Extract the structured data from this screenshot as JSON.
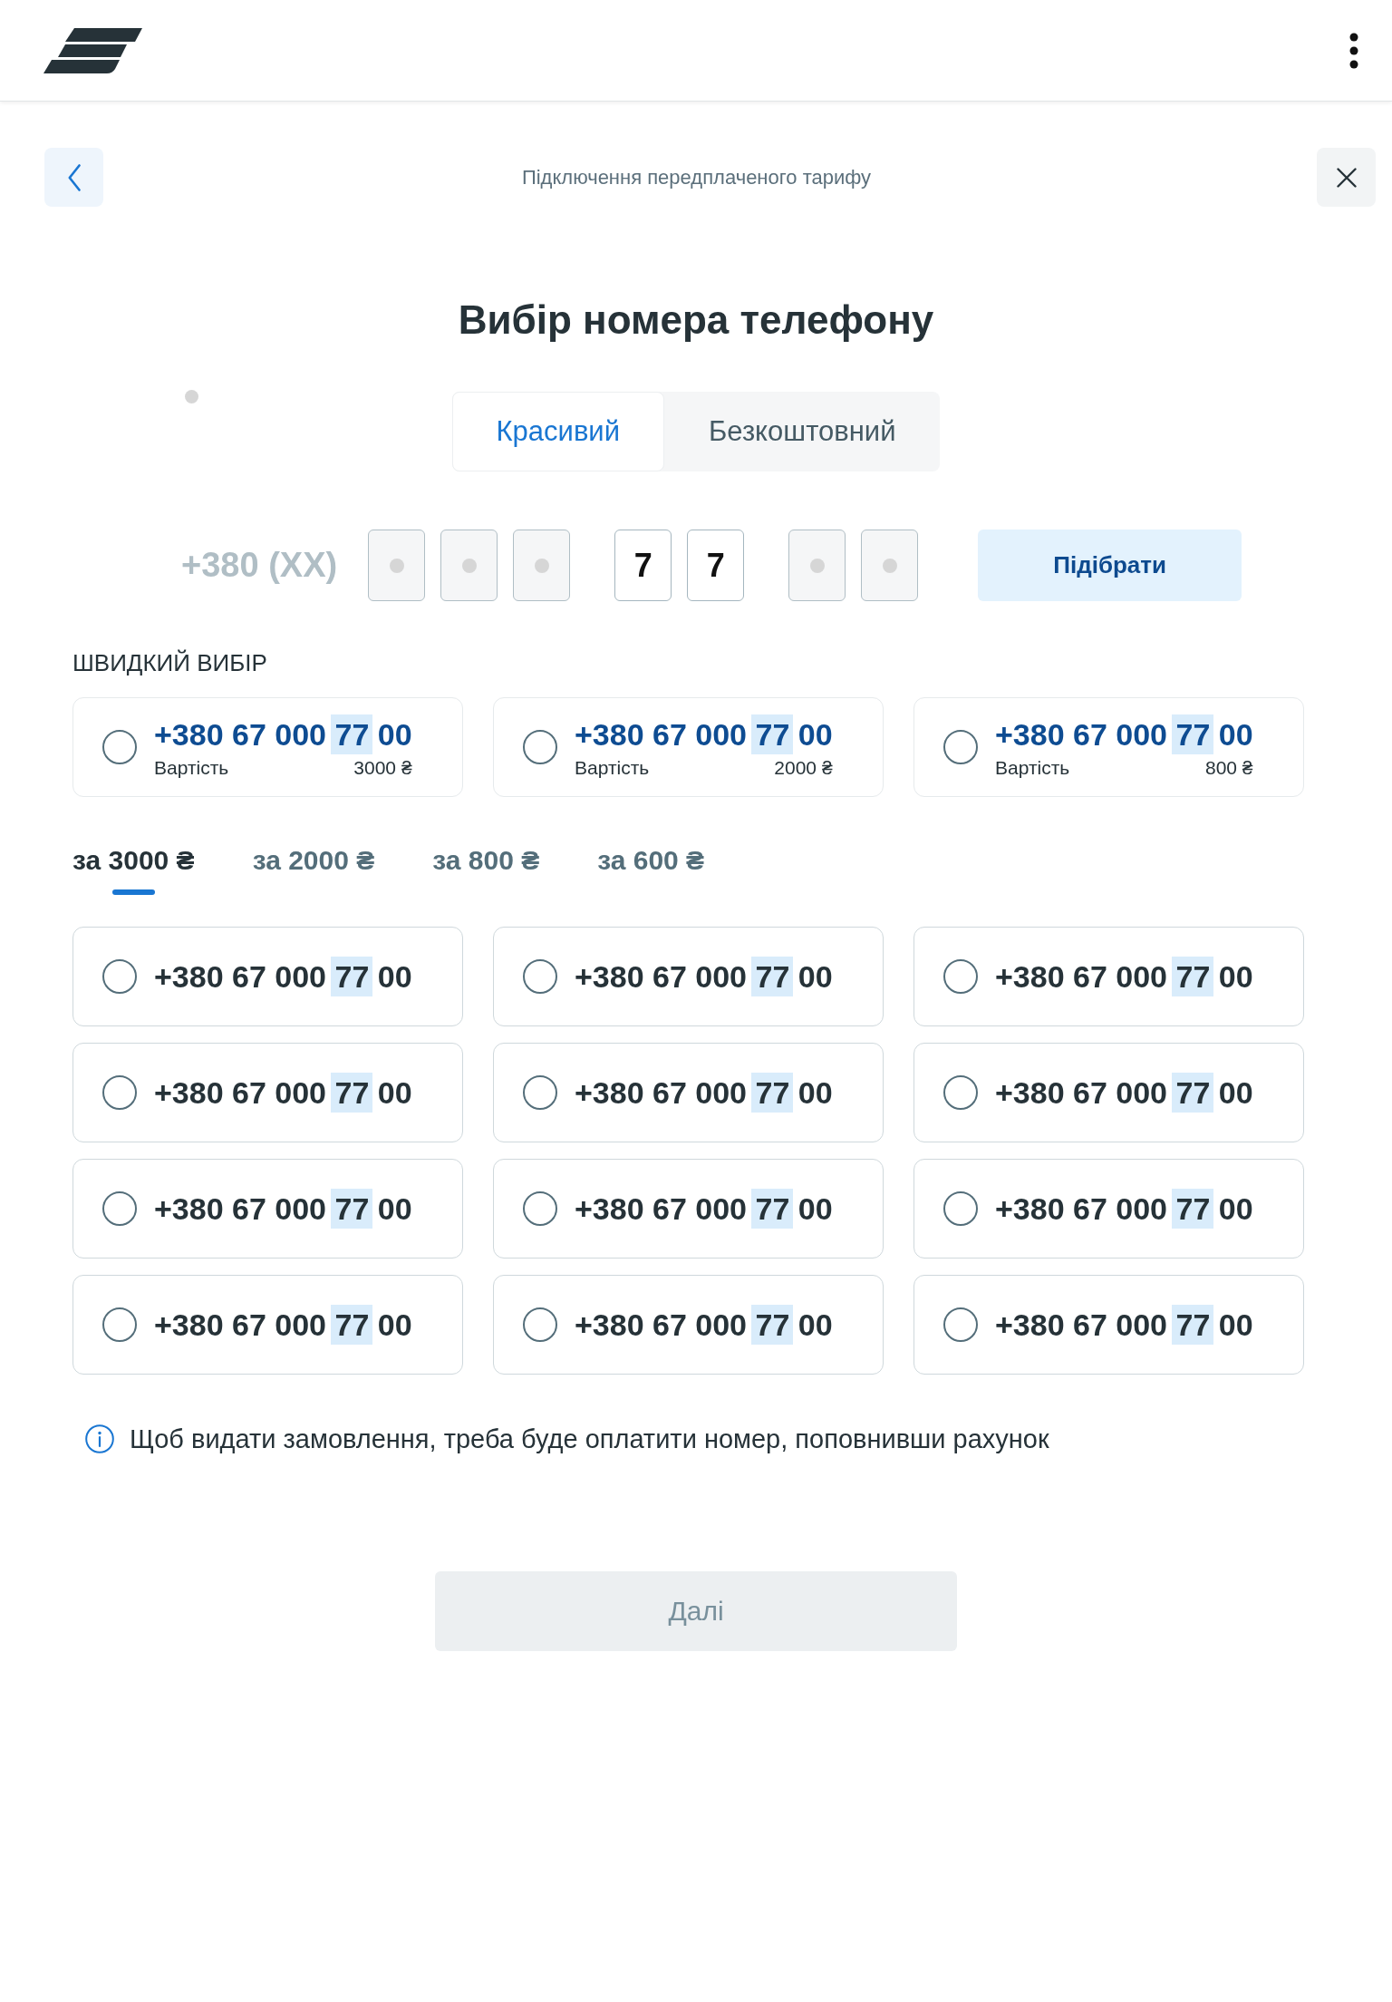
{
  "nav": {
    "title": "Підключення передплаченого тарифу"
  },
  "heading": "Вибір номера телефону",
  "mode_tabs": [
    {
      "label": "Красивий",
      "selected": true
    },
    {
      "label": "Безкоштовний",
      "selected": false
    }
  ],
  "number_mask": {
    "prefix": "+380 (XX)",
    "groups": [
      {
        "cells": [
          {
            "filled": false
          },
          {
            "filled": false
          },
          {
            "filled": false
          }
        ]
      },
      {
        "cells": [
          {
            "filled": true,
            "value": "7"
          },
          {
            "filled": true,
            "value": "7"
          }
        ]
      },
      {
        "cells": [
          {
            "filled": false
          },
          {
            "filled": false
          }
        ]
      }
    ],
    "button": "Підібрати"
  },
  "quick_pick": {
    "title": "ШВИДКИЙ ВИБІР",
    "items": [
      {
        "number": {
          "before": "+380 67 000",
          "match": "77",
          "after": "00"
        },
        "cost_label": "Вартість",
        "price": "3000 ₴",
        "selected": false
      },
      {
        "number": {
          "before": "+380 67 000",
          "match": "77",
          "after": "00"
        },
        "cost_label": "Вартість",
        "price": "2000 ₴",
        "selected": false
      },
      {
        "number": {
          "before": "+380 67 000",
          "match": "77",
          "after": "00"
        },
        "cost_label": "Вартість",
        "price": "800 ₴",
        "selected": false
      }
    ]
  },
  "price_tabs": [
    {
      "label": "за 3000 ₴",
      "selected": true
    },
    {
      "label": "за 2000 ₴",
      "selected": false
    },
    {
      "label": "за 800 ₴",
      "selected": false
    },
    {
      "label": "за 600 ₴",
      "selected": false
    }
  ],
  "numbers": [
    {
      "number": {
        "before": "+380 67 000",
        "match": "77",
        "after": "00"
      },
      "selected": false
    },
    {
      "number": {
        "before": "+380 67 000",
        "match": "77",
        "after": "00"
      },
      "selected": false
    },
    {
      "number": {
        "before": "+380 67 000",
        "match": "77",
        "after": "00"
      },
      "selected": false
    },
    {
      "number": {
        "before": "+380 67 000",
        "match": "77",
        "after": "00"
      },
      "selected": false
    },
    {
      "number": {
        "before": "+380 67 000",
        "match": "77",
        "after": "00"
      },
      "selected": false
    },
    {
      "number": {
        "before": "+380 67 000",
        "match": "77",
        "after": "00"
      },
      "selected": false
    },
    {
      "number": {
        "before": "+380 67 000",
        "match": "77",
        "after": "00"
      },
      "selected": false
    },
    {
      "number": {
        "before": "+380 67 000",
        "match": "77",
        "after": "00"
      },
      "selected": false
    },
    {
      "number": {
        "before": "+380 67 000",
        "match": "77",
        "after": "00"
      },
      "selected": false
    },
    {
      "number": {
        "before": "+380 67 000",
        "match": "77",
        "after": "00"
      },
      "selected": false
    },
    {
      "number": {
        "before": "+380 67 000",
        "match": "77",
        "after": "00"
      },
      "selected": false
    },
    {
      "number": {
        "before": "+380 67 000",
        "match": "77",
        "after": "00"
      },
      "selected": false
    }
  ],
  "info": "Щоб видати замовлення, треба буде оплатити номер, поповнивши рахунок",
  "next_button": {
    "label": "Далі",
    "disabled": true
  }
}
